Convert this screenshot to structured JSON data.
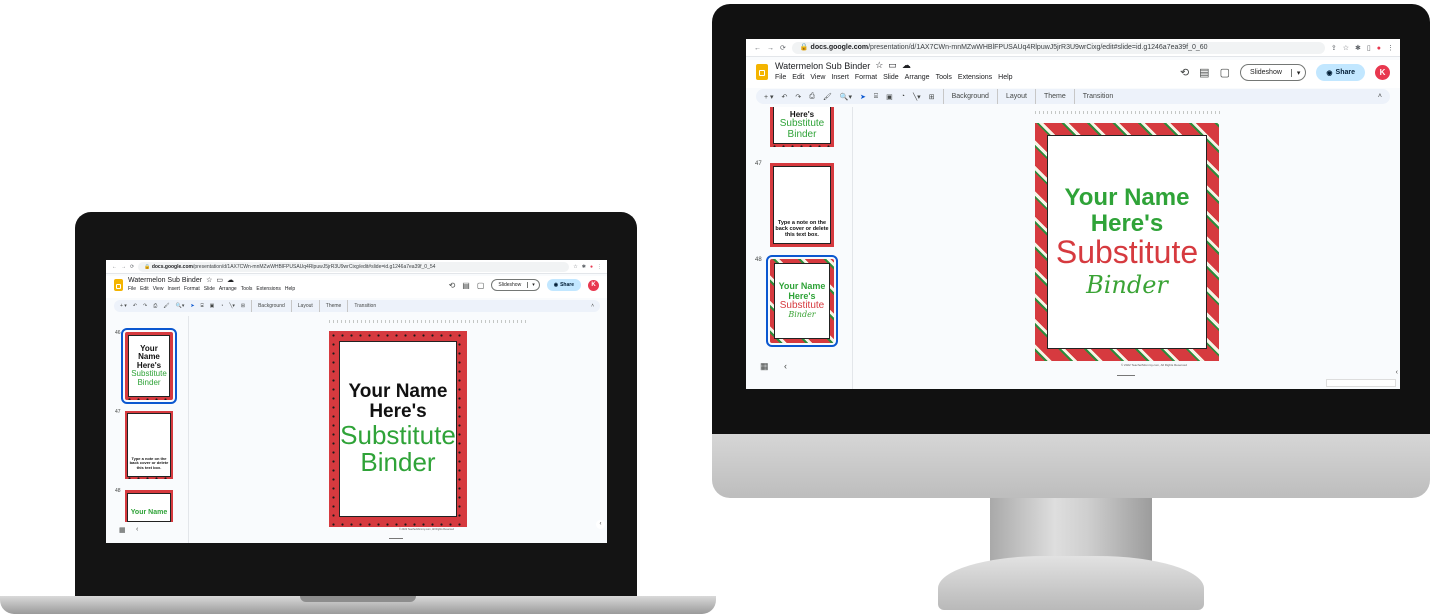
{
  "browser": {
    "url_host": "docs.google.com",
    "url_path_laptop": "/presentation/d/1AX7CWn-mnMZwWHBlFPUSAUq4RlpuwJ5jrR3U9wrCixg/edit#slide=id.g1246a7ea39f_0_54",
    "url_path_desktop": "/presentation/d/1AX7CWn-mnMZwWHBlFPUSAUq4RlpuwJ5jrR3U9wrCixg/edit#slide=id.g1246a7ea39f_0_60"
  },
  "app": {
    "doc_title": "Watermelon Sub Binder",
    "menu": [
      "File",
      "Edit",
      "View",
      "Insert",
      "Format",
      "Slide",
      "Arrange",
      "Tools",
      "Extensions",
      "Help"
    ],
    "slideshow_label": "Slideshow",
    "share_label": "Share",
    "avatar_letter": "K"
  },
  "toolbar": {
    "background": "Background",
    "layout": "Layout",
    "theme": "Theme",
    "transition": "Transition"
  },
  "slides": {
    "num_46": "46",
    "num_47": "47",
    "num_48": "48",
    "line1": "Your Name",
    "line2": "Here's",
    "line3": "Substitute",
    "line4": "Binder",
    "note": "Type a note on the back cover or delete this text box.",
    "copyright": "© 2022 TeacherMommy.com, All Rights Reserved"
  },
  "colors": {
    "accent_blue": "#0b57d0",
    "share_bg": "#c2e7ff",
    "watermelon_red": "#d63a3f",
    "title_green": "#2fa338",
    "avatar_red": "#e8384f"
  }
}
